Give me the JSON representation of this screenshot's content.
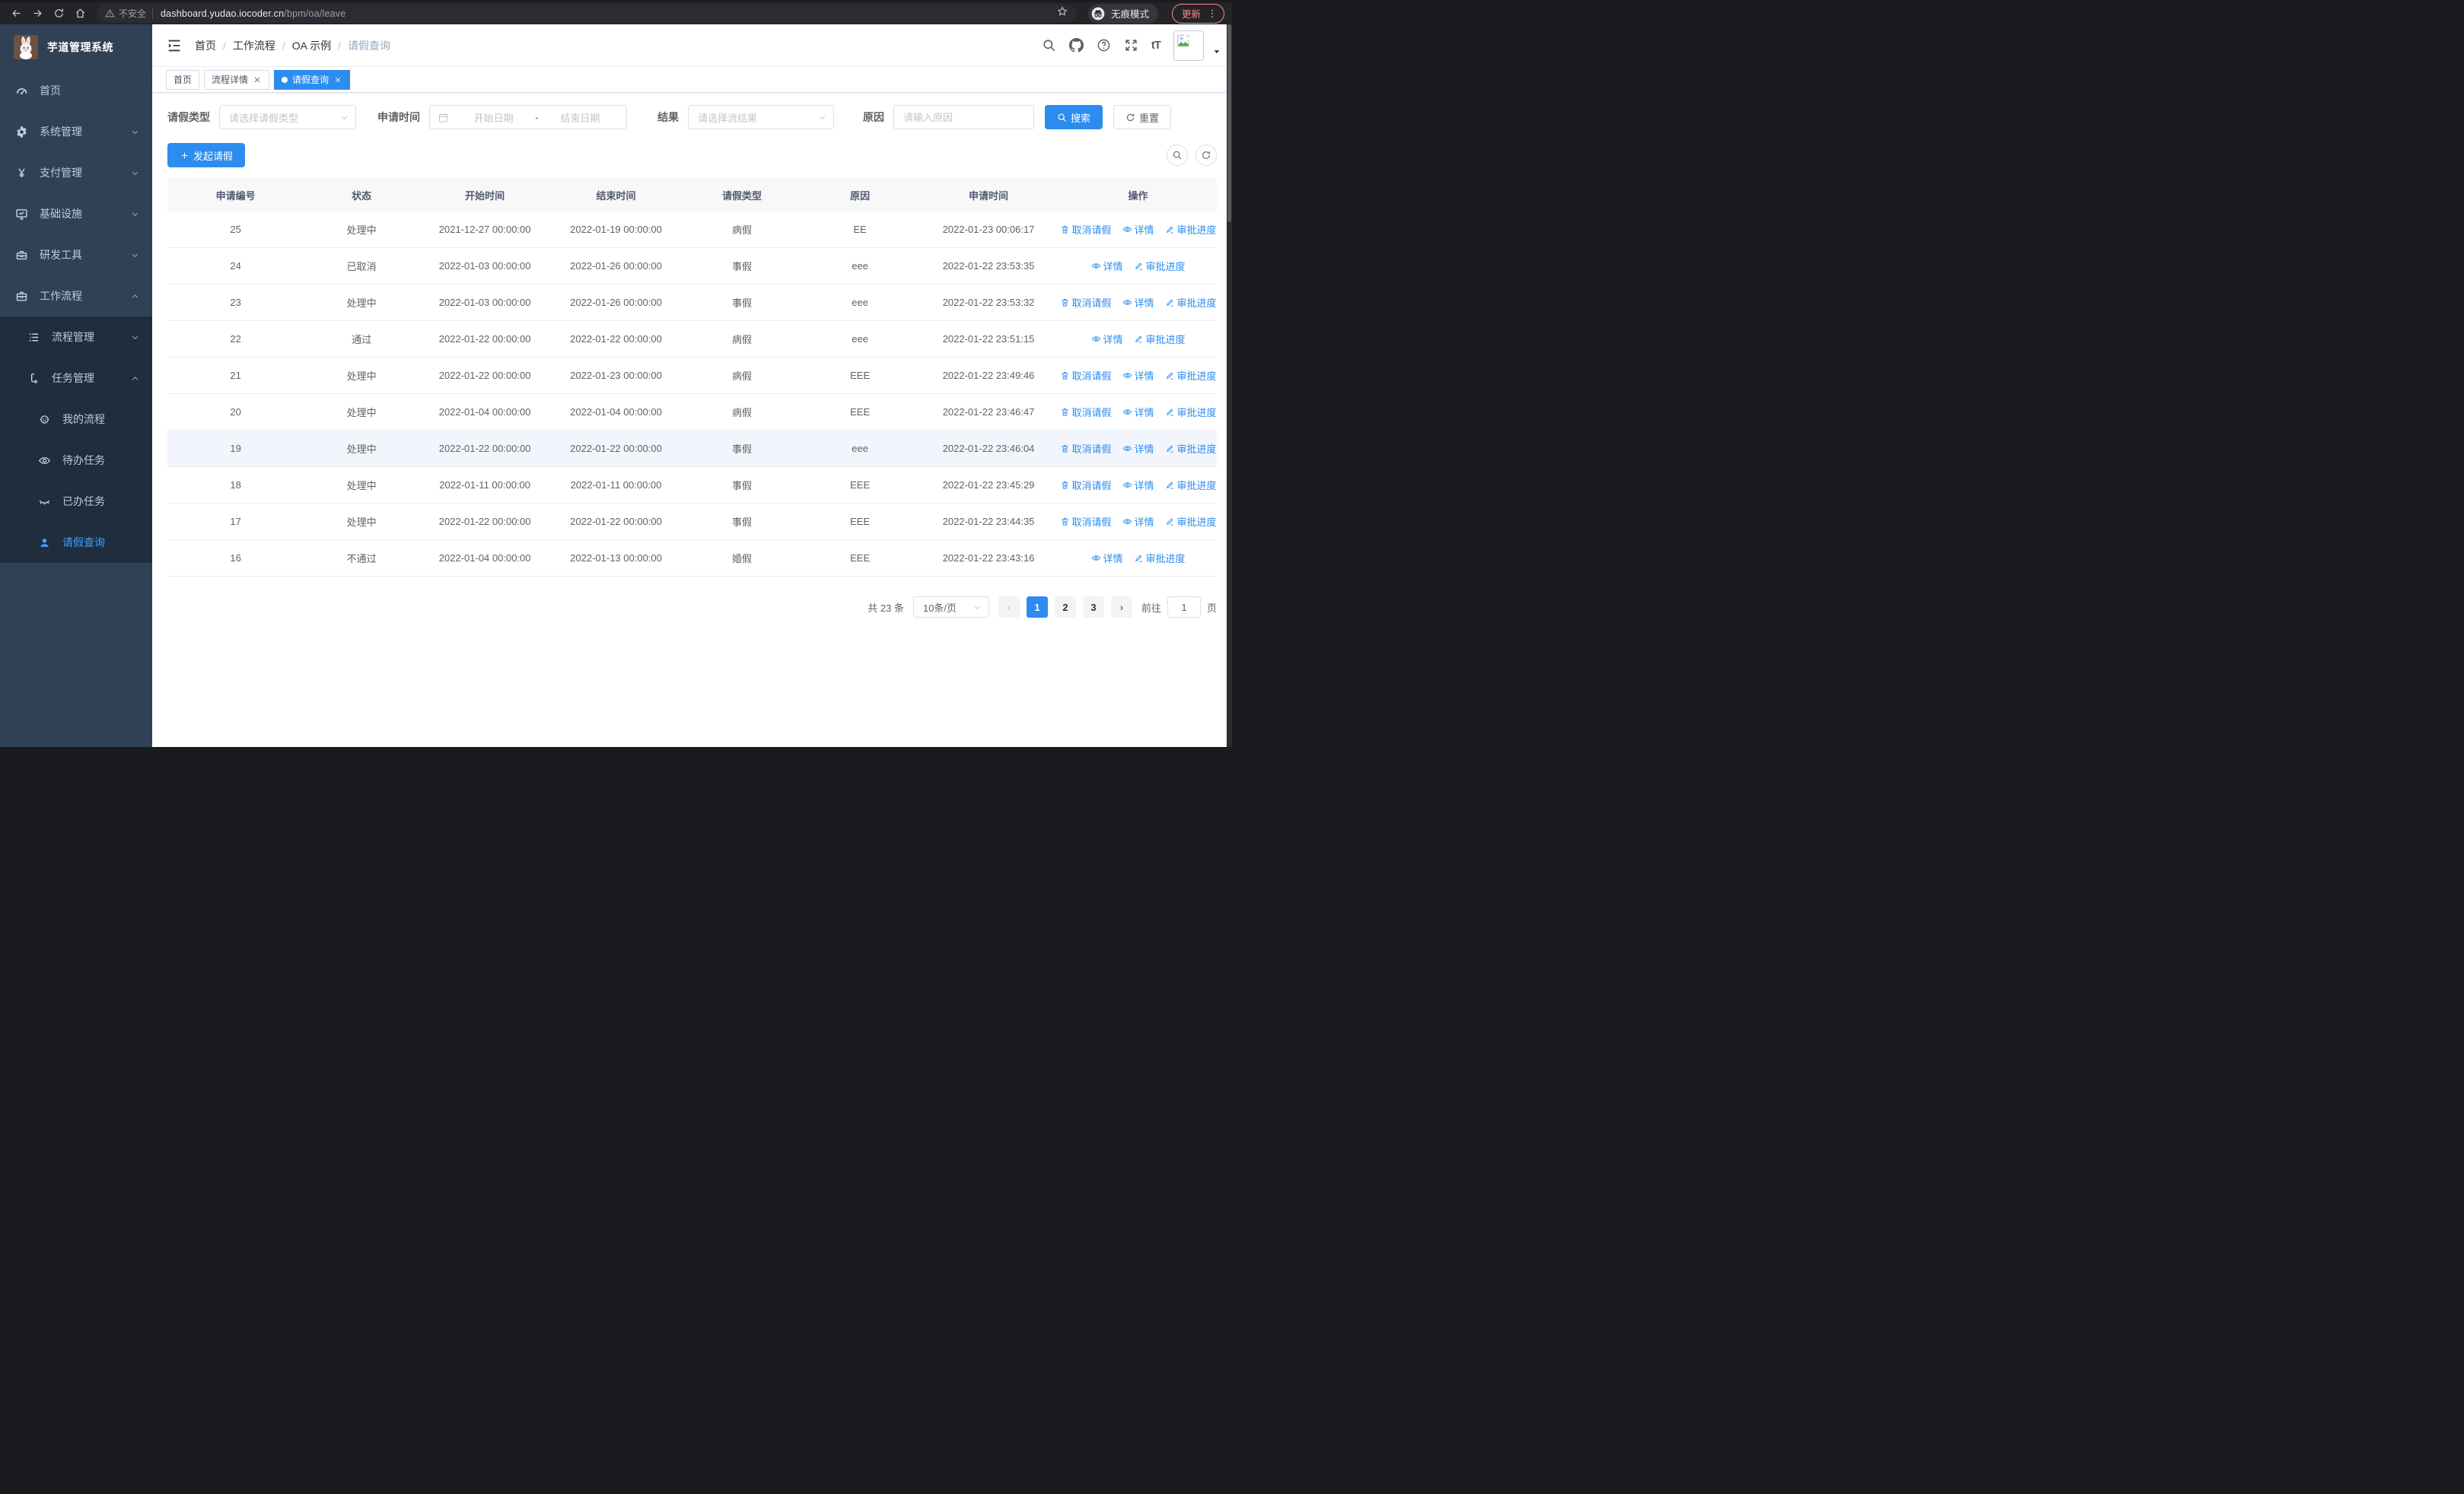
{
  "browser": {
    "security_label": "不安全",
    "url_domain": "dashboard.yudao.iocoder.cn",
    "url_path": "/bpm/oa/leave",
    "incognito_label": "无痕模式",
    "update_label": "更新"
  },
  "sidebar": {
    "logo_title": "芋道管理系统",
    "items": [
      {
        "label": "首页",
        "icon": "gauge-icon",
        "level": 1,
        "chevron": "",
        "active": false
      },
      {
        "label": "系统管理",
        "icon": "gear-icon",
        "level": 1,
        "chevron": "down",
        "active": false
      },
      {
        "label": "支付管理",
        "icon": "yen-icon",
        "level": 1,
        "chevron": "down",
        "active": false
      },
      {
        "label": "基础设施",
        "icon": "monitor-icon",
        "level": 1,
        "chevron": "down",
        "active": false
      },
      {
        "label": "研发工具",
        "icon": "toolbox-icon",
        "level": 1,
        "chevron": "down",
        "active": false
      },
      {
        "label": "工作流程",
        "icon": "briefcase-icon",
        "level": 1,
        "chevron": "up",
        "active": false
      },
      {
        "label": "流程管理",
        "icon": "list-icon",
        "level": 2,
        "chevron": "down",
        "active": false
      },
      {
        "label": "任务管理",
        "icon": "flow-icon",
        "level": 2,
        "chevron": "up",
        "active": false
      },
      {
        "label": "我的流程",
        "icon": "robot-icon",
        "level": 3,
        "chevron": "",
        "active": false
      },
      {
        "label": "待办任务",
        "icon": "eye-icon",
        "level": 3,
        "chevron": "",
        "active": false
      },
      {
        "label": "已办任务",
        "icon": "eye-closed-icon",
        "level": 3,
        "chevron": "",
        "active": false
      },
      {
        "label": "请假查询",
        "icon": "user-icon",
        "level": 3,
        "chevron": "",
        "active": true
      }
    ]
  },
  "navbar": {
    "breadcrumb": [
      "首页",
      "工作流程",
      "OA 示例",
      "请假查询"
    ]
  },
  "tabs": [
    {
      "label": "首页",
      "closable": false,
      "active": false
    },
    {
      "label": "流程详情",
      "closable": true,
      "active": false
    },
    {
      "label": "请假查询",
      "closable": true,
      "active": true
    }
  ],
  "filters": {
    "leave_type_label": "请假类型",
    "leave_type_placeholder": "请选择请假类型",
    "apply_time_label": "申请时间",
    "date_start_placeholder": "开始日期",
    "date_separator": "-",
    "date_end_placeholder": "结束日期",
    "result_label": "结果",
    "result_placeholder": "请选择流结果",
    "reason_label": "原因",
    "reason_placeholder": "请输入原因",
    "search_label": "搜索",
    "reset_label": "重置"
  },
  "toolbar": {
    "create_label": "发起请假"
  },
  "table": {
    "columns": [
      "申请编号",
      "状态",
      "开始时间",
      "结束时间",
      "请假类型",
      "原因",
      "申请时间",
      "操作"
    ],
    "action_labels": {
      "cancel": "取消请假",
      "detail": "详情",
      "progress": "审批进度"
    },
    "rows": [
      {
        "id": "25",
        "status": "处理中",
        "start": "2021-12-27 00:00:00",
        "end": "2022-01-19 00:00:00",
        "type": "病假",
        "reason": "EE",
        "apply_time": "2022-01-23 00:06:17",
        "actions": [
          "cancel",
          "detail",
          "progress"
        ],
        "highlight": false
      },
      {
        "id": "24",
        "status": "已取消",
        "start": "2022-01-03 00:00:00",
        "end": "2022-01-26 00:00:00",
        "type": "事假",
        "reason": "eee",
        "apply_time": "2022-01-22 23:53:35",
        "actions": [
          "detail",
          "progress"
        ],
        "highlight": false
      },
      {
        "id": "23",
        "status": "处理中",
        "start": "2022-01-03 00:00:00",
        "end": "2022-01-26 00:00:00",
        "type": "事假",
        "reason": "eee",
        "apply_time": "2022-01-22 23:53:32",
        "actions": [
          "cancel",
          "detail",
          "progress"
        ],
        "highlight": false
      },
      {
        "id": "22",
        "status": "通过",
        "start": "2022-01-22 00:00:00",
        "end": "2022-01-22 00:00:00",
        "type": "病假",
        "reason": "eee",
        "apply_time": "2022-01-22 23:51:15",
        "actions": [
          "detail",
          "progress"
        ],
        "highlight": false
      },
      {
        "id": "21",
        "status": "处理中",
        "start": "2022-01-22 00:00:00",
        "end": "2022-01-23 00:00:00",
        "type": "病假",
        "reason": "EEE",
        "apply_time": "2022-01-22 23:49:46",
        "actions": [
          "cancel",
          "detail",
          "progress"
        ],
        "highlight": false
      },
      {
        "id": "20",
        "status": "处理中",
        "start": "2022-01-04 00:00:00",
        "end": "2022-01-04 00:00:00",
        "type": "病假",
        "reason": "EEE",
        "apply_time": "2022-01-22 23:46:47",
        "actions": [
          "cancel",
          "detail",
          "progress"
        ],
        "highlight": false
      },
      {
        "id": "19",
        "status": "处理中",
        "start": "2022-01-22 00:00:00",
        "end": "2022-01-22 00:00:00",
        "type": "事假",
        "reason": "eee",
        "apply_time": "2022-01-22 23:46:04",
        "actions": [
          "cancel",
          "detail",
          "progress"
        ],
        "highlight": true
      },
      {
        "id": "18",
        "status": "处理中",
        "start": "2022-01-11 00:00:00",
        "end": "2022-01-11 00:00:00",
        "type": "事假",
        "reason": "EEE",
        "apply_time": "2022-01-22 23:45:29",
        "actions": [
          "cancel",
          "detail",
          "progress"
        ],
        "highlight": false
      },
      {
        "id": "17",
        "status": "处理中",
        "start": "2022-01-22 00:00:00",
        "end": "2022-01-22 00:00:00",
        "type": "事假",
        "reason": "EEE",
        "apply_time": "2022-01-22 23:44:35",
        "actions": [
          "cancel",
          "detail",
          "progress"
        ],
        "highlight": false
      },
      {
        "id": "16",
        "status": "不通过",
        "start": "2022-01-04 00:00:00",
        "end": "2022-01-13 00:00:00",
        "type": "婚假",
        "reason": "EEE",
        "apply_time": "2022-01-22 23:43:16",
        "actions": [
          "detail",
          "progress"
        ],
        "highlight": false
      }
    ]
  },
  "pagination": {
    "total_text": "共 23 条",
    "page_size": "10条/页",
    "pages": [
      "1",
      "2",
      "3"
    ],
    "active_page": "1",
    "goto_label": "前往",
    "goto_value": "1",
    "page_suffix": "页"
  },
  "colors": {
    "primary": "#2d8cf0",
    "sidebar_bg": "#304156",
    "sidebar_submenu_bg": "#1f2d3d",
    "sidebar_active_text": "#409eff",
    "chrome_bg": "#232428",
    "update_accent": "#f28b82",
    "table_header_bg": "#f8f8f9"
  }
}
